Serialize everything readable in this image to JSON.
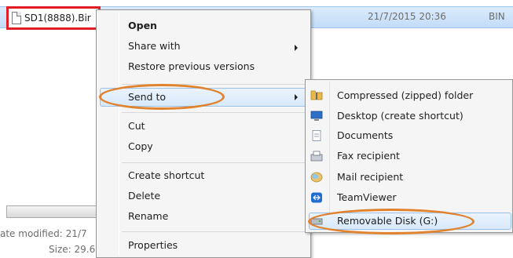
{
  "explorer": {
    "file_name": "SD1(8888).Bir",
    "file_date": "21/7/2015 20:36",
    "file_type": "BIN",
    "details_modified": "ate modified: 21/7",
    "details_size": "Size: 29.6"
  },
  "context_menu": {
    "items": [
      {
        "label": "Open"
      },
      {
        "label": "Share with"
      },
      {
        "label": "Restore previous versions"
      },
      {
        "label": "Send to"
      },
      {
        "label": "Cut"
      },
      {
        "label": "Copy"
      },
      {
        "label": "Create shortcut"
      },
      {
        "label": "Delete"
      },
      {
        "label": "Rename"
      },
      {
        "label": "Properties"
      }
    ]
  },
  "send_to_menu": {
    "items": [
      {
        "label": "Compressed (zipped) folder",
        "icon": "zip-folder-icon"
      },
      {
        "label": "Desktop (create shortcut)",
        "icon": "desktop-icon"
      },
      {
        "label": "Documents",
        "icon": "documents-icon"
      },
      {
        "label": "Fax recipient",
        "icon": "fax-icon"
      },
      {
        "label": "Mail recipient",
        "icon": "mail-icon"
      },
      {
        "label": "TeamViewer",
        "icon": "teamviewer-icon"
      },
      {
        "label": "Removable Disk (G:)",
        "icon": "removable-disk-icon"
      }
    ]
  },
  "colors": {
    "highlight_box": "#e11c24",
    "annotation_oval": "#e0822e",
    "selection_bg": "#d8e9fb"
  }
}
